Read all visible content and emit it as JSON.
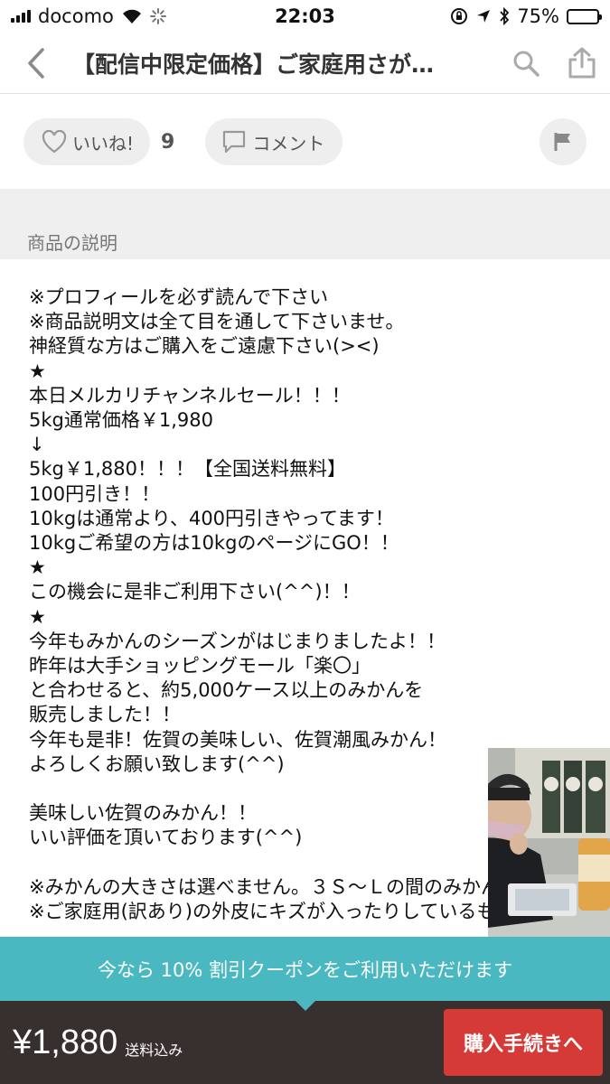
{
  "status_bar": {
    "carrier": "docomo",
    "time": "22:03",
    "battery": "75%",
    "battery_level": 0.75
  },
  "nav": {
    "title": "【配信中限定価格】ご家庭用さが…"
  },
  "actions": {
    "like_label": "いいね!",
    "like_count": "9",
    "comment_label": "コメント"
  },
  "section": {
    "title": "商品の説明"
  },
  "description": {
    "lines": [
      "※プロフィールを必ず読んで下さい",
      "※商品説明文は全て目を通して下さいませ。",
      "神経質な方はご購入をご遠慮下さい(><)",
      "★",
      "本日メルカリチャンネルセール！！！",
      "5kg通常価格￥1,980",
      "↓",
      "5kg￥1,880！！！【全国送料無料】",
      "100円引き！！",
      "10kgは通常より、400円引きやってます！",
      "10kgご希望の方は10kgのページにGO！！",
      "★",
      "この機会に是非ご利用下さい(^^)！！",
      "★",
      "今年もみかんのシーズンがはじまりましたよ！！",
      "昨年は大手ショッピングモール「楽〇」",
      "と合わせると、約5,000ケース以上のみかんを",
      "販売しました！！",
      "今年も是非！佐賀の美味しい、佐賀潮風みかん！",
      "よろしくお願い致します(^^)",
      "",
      "美味しい佐賀のみかん！！",
      "いい評価を頂いております(^^)",
      "",
      "※みかんの大きさは選べません。３Ｓ～Ｌの間のみかんです。",
      "※ご家庭用(訳あり)の外皮にキズが入ったりしているも"
    ]
  },
  "coupon": {
    "text": "今なら 10% 割引クーポンをご利用いただけます"
  },
  "footer": {
    "price": "¥1,880",
    "shipping": "送料込み",
    "buy_label": "購入手続きへ"
  },
  "colors": {
    "coupon_bg": "#4ab8c1",
    "footer_bg": "#38302f",
    "buy_button": "#d63a37"
  }
}
